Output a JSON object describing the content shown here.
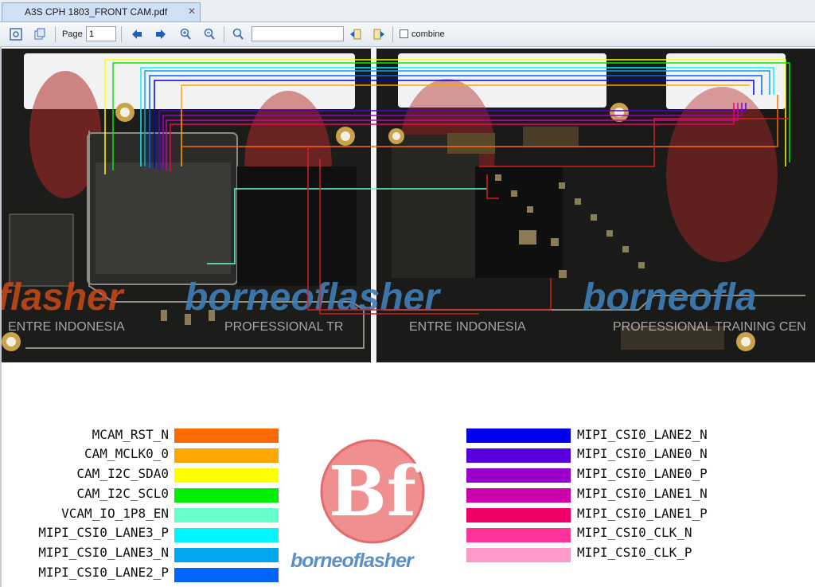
{
  "tab": {
    "title": "A3S CPH 1803_FRONT CAM.pdf",
    "close": "✕"
  },
  "toolbar": {
    "page_label": "Page",
    "page_value": "1",
    "search_value": "",
    "combine_label": "combine"
  },
  "watermark": {
    "brand_left": "flasher",
    "brand_center": "borneoflasher",
    "brand_right": "borneofla",
    "tag_1": "ENTRE INDONESIA",
    "tag_2": "PROFESSIONAL TR",
    "tag_3": "ENTRE INDONESIA",
    "tag_4": "PROFESSIONAL TRAINING CEN"
  },
  "logo": {
    "brand": "borneoflasher",
    "monogram": "Bf"
  },
  "legend_left": [
    {
      "label": "MCAM_RST_N",
      "color": "#ff6a00"
    },
    {
      "label": "CAM_MCLK0_0",
      "color": "#ffa500"
    },
    {
      "label": "CAM_I2C_SDA0",
      "color": "#ffff00"
    },
    {
      "label": "CAM_I2C_SCL0",
      "color": "#00ee00"
    },
    {
      "label": "VCAM_IO_1P8_EN",
      "color": "#66ffcc"
    },
    {
      "label": "MIPI_CSI0_LANE3_P",
      "color": "#00f5ff"
    },
    {
      "label": "MIPI_CSI0_LANE3_N",
      "color": "#00a8f0"
    },
    {
      "label": "MIPI_CSI0_LANE2_P",
      "color": "#0066ff"
    }
  ],
  "legend_right": [
    {
      "label": "MIPI_CSI0_LANE2_N",
      "color": "#0000ee"
    },
    {
      "label": "MIPI_CSI0_LANE0_N",
      "color": "#5500dd"
    },
    {
      "label": "MIPI_CSI0_LANE0_P",
      "color": "#9900cc"
    },
    {
      "label": "MIPI_CSI0_LANE1_N",
      "color": "#cc00aa"
    },
    {
      "label": "MIPI_CSI0_LANE1_P",
      "color": "#ee0066"
    },
    {
      "label": "MIPI_CSI0_CLK_N",
      "color": "#ff3399"
    },
    {
      "label": "MIPI_CSI0_CLK_P",
      "color": "#ff99cc"
    }
  ]
}
